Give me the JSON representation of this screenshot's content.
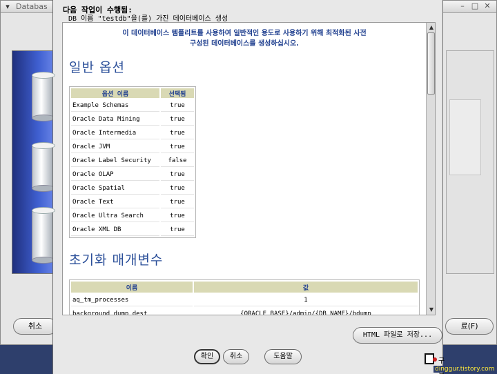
{
  "background_window": {
    "title": "Databas",
    "controls": [
      "–",
      "□",
      "✕"
    ],
    "cancel_label": "취소",
    "finish_label": "료(F)"
  },
  "dialog": {
    "heading": "다음 작업이 수행됨:",
    "subheading": "DB 이름 \"testdb\"을(를) 가진 데이터베이스 생성",
    "intro_line1": "이 데이터베이스 템플리트를 사용하여 일반적인 용도로 사용하기 위해 최적화된 사전",
    "intro_line2": "구성된 데이터베이스를 생성하십시오.",
    "general_options_title": "일반 옵션",
    "options_table": {
      "headers": [
        "옵션 이름",
        "선택됨"
      ],
      "rows": [
        [
          "Example Schemas",
          "true"
        ],
        [
          "Oracle Data Mining",
          "true"
        ],
        [
          "Oracle Intermedia",
          "true"
        ],
        [
          "Oracle JVM",
          "true"
        ],
        [
          "Oracle Label Security",
          "false"
        ],
        [
          "Oracle OLAP",
          "true"
        ],
        [
          "Oracle Spatial",
          "true"
        ],
        [
          "Oracle Text",
          "true"
        ],
        [
          "Oracle Ultra Search",
          "true"
        ],
        [
          "Oracle XML DB",
          "true"
        ]
      ]
    },
    "init_params_title": "초기화 매개변수",
    "params_table": {
      "headers": [
        "이름",
        "값"
      ],
      "rows": [
        [
          "aq_tm_processes",
          "1"
        ],
        [
          "background_dump_dest",
          "{ORACLE_BASE}/admin/{DB_NAME}/bdump"
        ]
      ]
    },
    "save_html_label": "HTML 파일로 저장...",
    "ok_label": "확인",
    "cancel_label": "취소",
    "help_label": "도움말",
    "status_label": "구름"
  },
  "watermark": "dinggur.tistory.com"
}
